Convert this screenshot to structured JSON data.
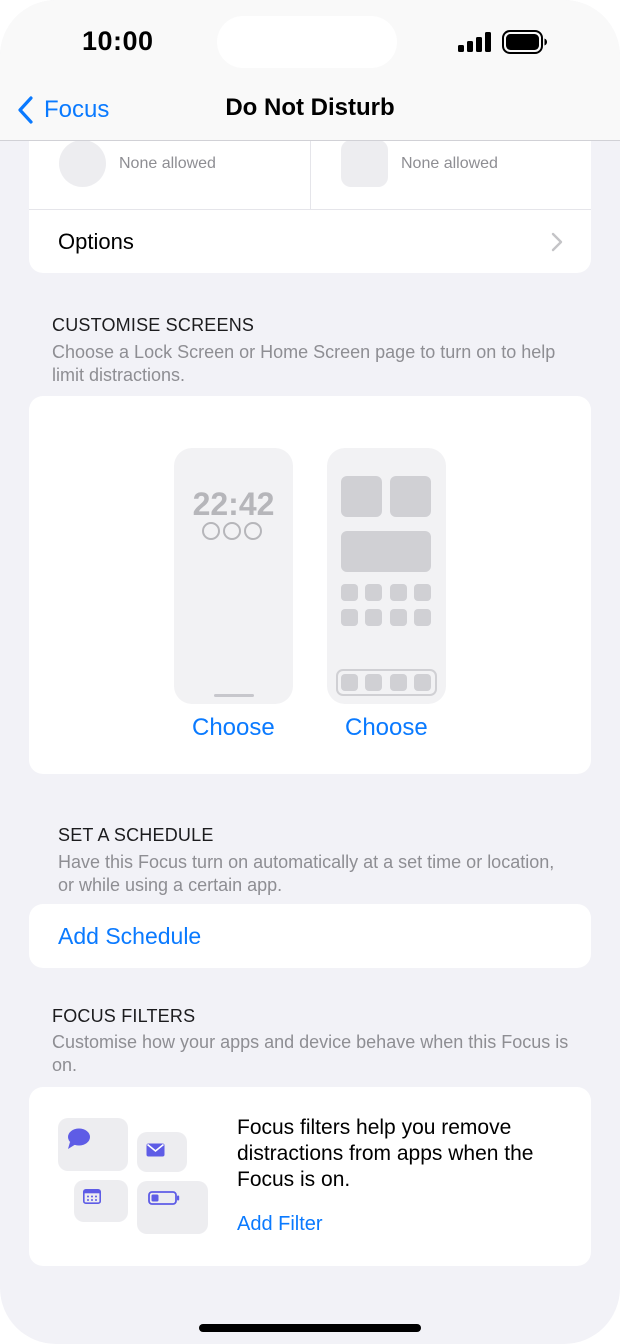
{
  "status_bar": {
    "time": "10:00"
  },
  "nav": {
    "back_label": "Focus",
    "title": "Do Not Disturb"
  },
  "allowed": {
    "people_text": "None allowed",
    "apps_text": "None allowed"
  },
  "options": {
    "label": "Options"
  },
  "customise_screens": {
    "heading": "CUSTOMISE SCREENS",
    "description": "Choose a Lock Screen or Home Screen page to turn on to help limit distractions.",
    "lock_screen_time": "22:42",
    "choose_lock_label": "Choose",
    "choose_home_label": "Choose"
  },
  "schedule": {
    "heading": "SET A SCHEDULE",
    "description": "Have this Focus turn on automatically at a set time or location, or while using a certain app.",
    "add_label": "Add Schedule"
  },
  "filters": {
    "heading": "FOCUS FILTERS",
    "description": "Customise how your apps and device behave when this Focus is on.",
    "body": "Focus filters help you remove distractions from apps when the Focus is on.",
    "add_label": "Add Filter",
    "icons": [
      "message-icon",
      "mail-icon",
      "calendar-icon",
      "battery-icon"
    ]
  },
  "colors": {
    "accent": "#0a7aff",
    "filter_icon": "#5e5ce6",
    "background": "#f2f2f7"
  }
}
